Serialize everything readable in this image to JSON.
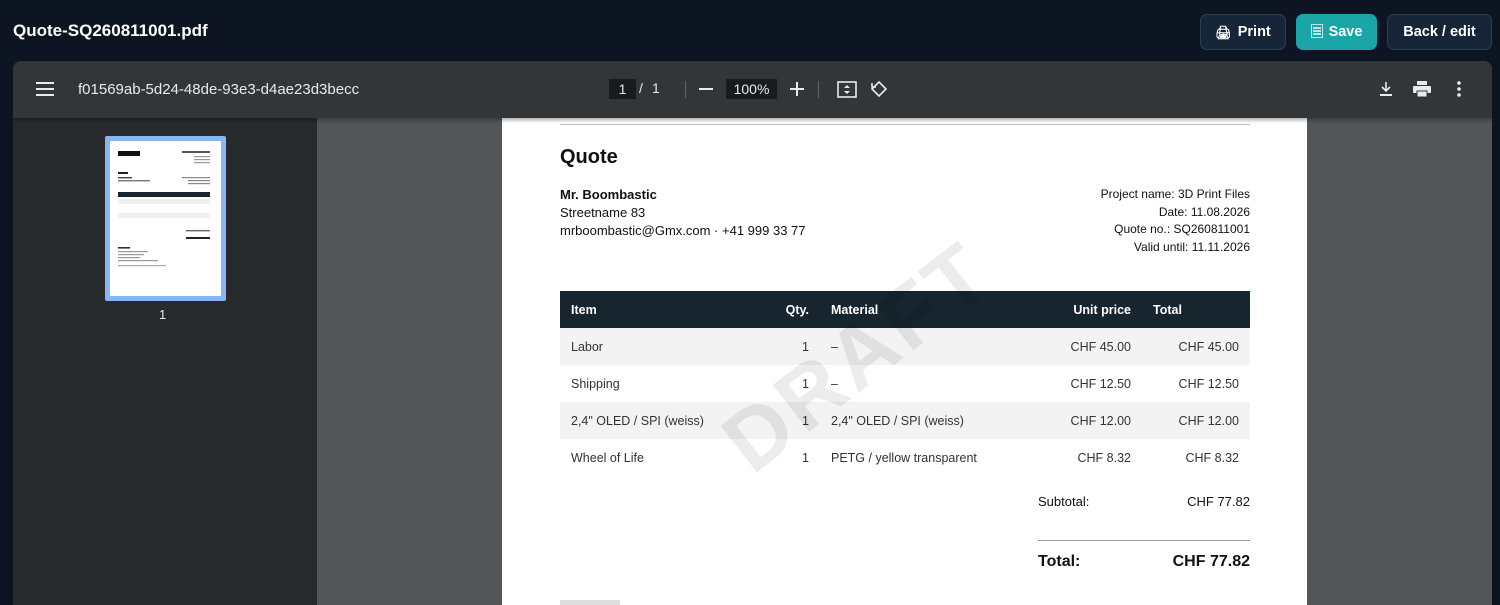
{
  "app": {
    "title": "Quote-SQ260811001.pdf",
    "print_label": "Print",
    "save_label": "Save",
    "back_label": "Back / edit",
    "colors": {
      "accent": "#1aa6a6",
      "header_bg": "#0c1521"
    }
  },
  "viewer": {
    "doc_id": "f01569ab-5d24-48de-93e3-d4ae23d3becc",
    "current_page": "1",
    "page_separator": "/",
    "total_pages": "1",
    "zoom": "100%",
    "thumbnail_label": "1",
    "icons": [
      "menu-icon",
      "zoom-out-icon",
      "zoom-in-icon",
      "fit-page-icon",
      "rotate-icon",
      "download-icon",
      "print-icon",
      "more-vert-icon"
    ]
  },
  "doc": {
    "title": "Quote",
    "client": {
      "name": "Mr. Boombastic",
      "street": "Streetname 83",
      "contact": "mrboombastic@Gmx.com · +41 999 33 77"
    },
    "meta": {
      "project": "Project name: 3D Print Files",
      "date": "Date: 11.08.2026",
      "quote_no": "Quote no.: SQ260811001",
      "valid_until": "Valid until: 11.11.2026"
    },
    "table": {
      "headers": {
        "item": "Item",
        "qty": "Qty.",
        "material": "Material",
        "unit_price": "Unit price",
        "total": "Total"
      },
      "rows": [
        {
          "item": "Labor",
          "qty": "1",
          "material": "–",
          "unit_price": "CHF 45.00",
          "total": "CHF 45.00"
        },
        {
          "item": "Shipping",
          "qty": "1",
          "material": "–",
          "unit_price": "CHF 12.50",
          "total": "CHF 12.50"
        },
        {
          "item": "2,4\" OLED / SPI (weiss)",
          "qty": "1",
          "material": "2,4\" OLED / SPI (weiss)",
          "unit_price": "CHF 12.00",
          "total": "CHF 12.00"
        },
        {
          "item": "Wheel of Life",
          "qty": "1",
          "material": "PETG / yellow transparent",
          "unit_price": "CHF 8.32",
          "total": "CHF 8.32"
        }
      ]
    },
    "subtotal_label": "Subtotal:",
    "subtotal_value": "CHF 77.82",
    "total_label": "Total:",
    "total_value": "CHF 77.82",
    "watermark": "DRAFT"
  }
}
